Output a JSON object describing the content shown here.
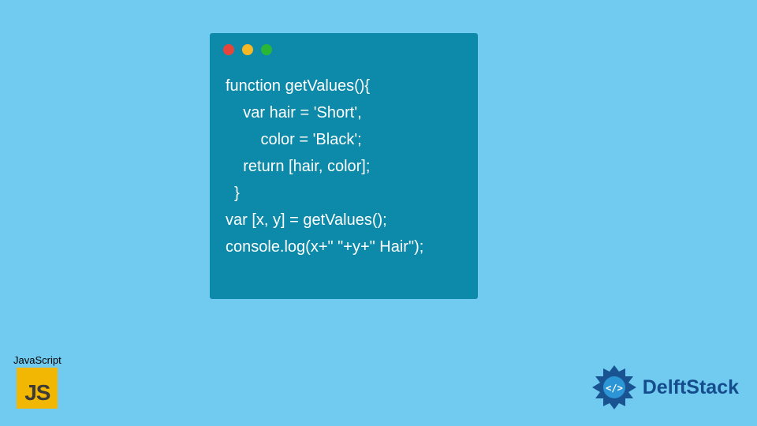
{
  "code": {
    "line1": "function getValues(){",
    "line2": "    var hair = 'Short',",
    "line3": "        color = 'Black';",
    "line4": "    return [hair, color];",
    "line5": "  }",
    "line6": "var [x, y] = getValues();",
    "line7": "console.log(x+\" \"+y+\" Hair\");"
  },
  "js_badge": {
    "label": "JavaScript",
    "icon_text": "JS"
  },
  "delft": {
    "text": "DelftStack"
  }
}
